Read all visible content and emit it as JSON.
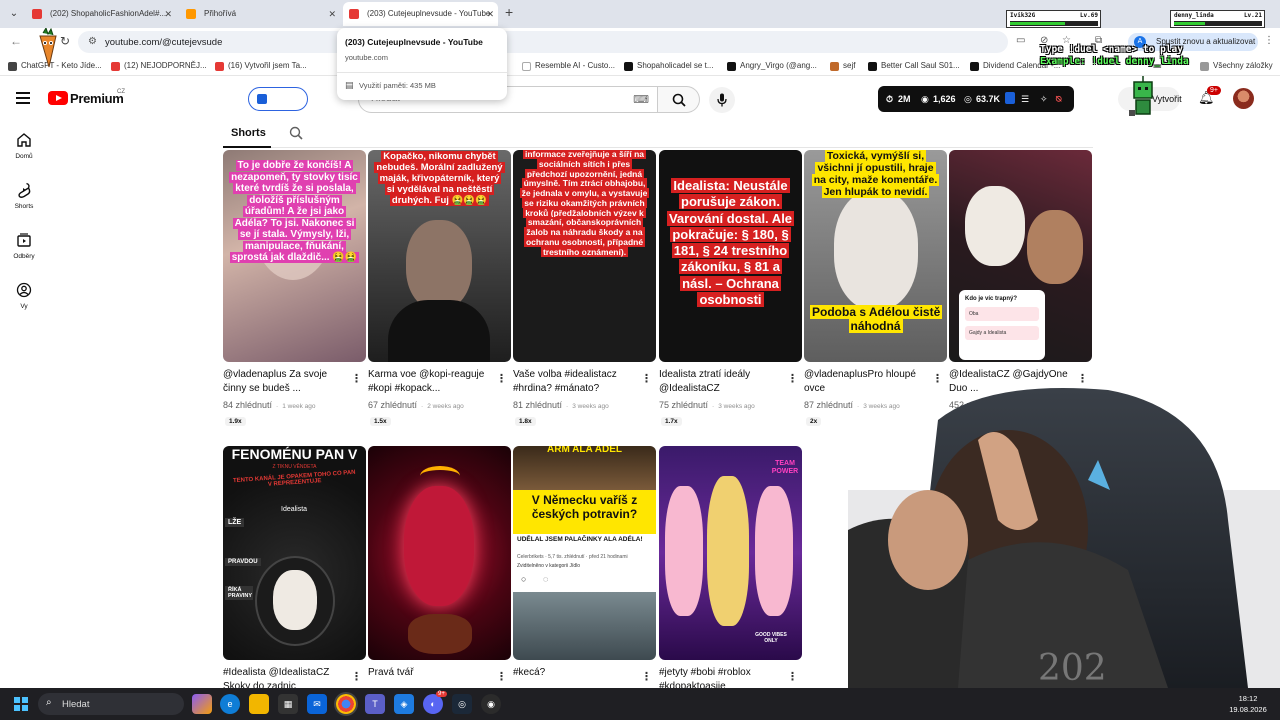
{
  "browser": {
    "tabs": [
      {
        "label": "(202) ShopaholicFashionAdel#...",
        "favicon_color": "#e53935"
      },
      {
        "label": "Přihořívá",
        "favicon_color": "#ff9800"
      },
      {
        "label": "(203) Cutejeuplnevsude - YouTube",
        "favicon_color": "#e53935"
      }
    ],
    "url": "youtube.com/@cutejevsude",
    "update_label": "Spustit znovu a aktualizovat",
    "bookmarks": [
      {
        "label": "ChatGPT - Keto Jíde...",
        "color": "#444"
      },
      {
        "label": "(12) NEJODPORNĚJ...",
        "color": "#e53935"
      },
      {
        "label": "(16) Vytvořil jsem Ta...",
        "color": "#e53935"
      },
      {
        "label": "Resemble AI - Custo...",
        "color": "#888"
      },
      {
        "label": "Shopaholicadel se t...",
        "color": "#111"
      },
      {
        "label": "Angry_Virgo (@ang...",
        "color": "#111"
      },
      {
        "label": "sejf",
        "color": "#c0692a"
      },
      {
        "label": "Better Call Saul S01...",
        "color": "#111"
      },
      {
        "label": "Dividend Calendar -...",
        "color": "#111"
      },
      {
        "label": "Všechny záložky",
        "color": "#777"
      }
    ],
    "tab_popup": {
      "title": "(203) Cutejeuplnevsude - YouTube",
      "host": "youtube.com",
      "memory": "Využití paměti: 435 MB"
    }
  },
  "youtube": {
    "logo_text": "Premium",
    "region": "CZ",
    "search_placeholder": "Hledat",
    "stats": {
      "s1": "2M",
      "s2": "1,626",
      "s3": "63.7K"
    },
    "create_label": "Vytvořit",
    "notifications": "9+",
    "sidebar": [
      {
        "label": "Domů",
        "icon": "home-icon"
      },
      {
        "label": "Shorts",
        "icon": "shorts-icon"
      },
      {
        "label": "Odběry",
        "icon": "subscriptions-icon"
      },
      {
        "label": "Vy",
        "icon": "you-icon"
      }
    ],
    "channel_tab": "Shorts",
    "shorts": [
      {
        "title": "@vladenaplus Za svoje činny se budeš ...",
        "views": "84 zhlédnutí",
        "ago": "1 week ago",
        "speed": "1.9x",
        "caption": "To je dobře že končíš! A nezapomeň, ty stovky tisíc které tvrdíš že si poslala, doložíš příslušným úřadům! A že jsi jako Adéla? To jsi. Nakonec si se jí stala. Výmysly, lži, manipulace, fňukání, sprostá jak dlaždič... 🤮🤮"
      },
      {
        "title": "Karma voe @kopi-reaguje #kopi #kopack...",
        "views": "67 zhlédnutí",
        "ago": "2 weeks ago",
        "speed": "1.5x",
        "caption": "Kopačko, nikomu chybět nebudeš. Morální zadlužený maják, křivopáterník, který si vydělával na neštěstí druhých. Fuj 🤮🤮🤮"
      },
      {
        "title": "Vaše volba #idealistacz #hrdina? #mánato?",
        "views": "81 zhlédnutí",
        "ago": "3 weeks ago",
        "speed": "1.8x",
        "caption": "informace zveřejňuje a šíří na sociálních sítích i přes předchozí upozornění, jedná úmyslně. Tím ztrácí obhajobu, že jednala v omylu, a vystavuje se riziku okamžitých právních kroků (předžalobních výzev k smazání, občanskoprávních žalob na náhradu škody a na ochranu osobnosti, případné trestního oznámení)."
      },
      {
        "title": "Idealista ztratí ideály @IdealistaCZ",
        "views": "75 zhlédnutí",
        "ago": "3 weeks ago",
        "speed": "1.7x",
        "caption": "Idealista: Neustále porušuje zákon. Varování dostal. Ale pokračuje: § 180, § 181, § 24 trestního zákoníku, § 81 a násl. – Ochrana osobnosti"
      },
      {
        "title": "@vladenaplusPro hloupé ovce",
        "views": "87 zhlédnutí",
        "ago": "3 weeks ago",
        "speed": "2x",
        "caption": "Toxická, vymýšlí si, všichni jí opustili, hraje na city, maže komentáře. Jen hlupák to nevidí.",
        "caption2": "Podoba s Adélou čistě náhodná"
      },
      {
        "title": "@IdealistaCZ @GajdyOne Duo ...",
        "views": "452 zhlédnutí",
        "ago": "",
        "speed": "",
        "poll_q": "Kdo je víc trapný?",
        "poll_a": "Oba",
        "poll_b": "Gajdy a Idealista"
      },
      {
        "title": "#Idealista @IdealistaCZ Skoky do zadnic",
        "views": "",
        "ago": "",
        "speed": "",
        "caption": "FENOMÉNU PAN V",
        "sub1": "Z TIKNU VĚNDETA",
        "sub2": "TENTO KANÁL JE OPAKEM TOHO CO PAN V REPREZENTUJE",
        "label": "Idealista",
        "side1": "LŽE",
        "side2": "PRAVDOU",
        "side3": "ŘÍKÁ PRAVINY"
      },
      {
        "title": "Pravá tvář",
        "views": "",
        "ago": "",
        "speed": ""
      },
      {
        "title": "#kecá?",
        "views": "",
        "ago": "",
        "speed": "",
        "top": "ARM ALA ADÉL",
        "caption": "V Německu vaříš z českých potravin?",
        "post_title": "UDĚLAL JSEM PALAČINKY ALA ADÉLA!",
        "post_meta": "Celerbrikets · 5,7 tis. zhlédnutí · před 21 hodinami",
        "post_cat": "Zviditelněno v kategorii Jídlo"
      },
      {
        "title": "#jetyty #bobi #roblox #kdopaktoasije",
        "views": "",
        "ago": "",
        "speed": "",
        "badge": "TEAM POWER",
        "mug": "GOOD VIBES ONLY"
      }
    ]
  },
  "overlay": {
    "hud1_name": "Ivik32G",
    "hud1_lvl": "Lv.69",
    "hud1_hp": 0.62,
    "hud2_name": "denny_linda",
    "hud2_lvl": "Lv.21",
    "hud2_hp": 0.35,
    "line1": "Type !duel <name> to play",
    "line2": "Example: !duel denny_linda"
  },
  "taskbar": {
    "search": "Hledat",
    "time": "18:12",
    "date": "19.08.2026",
    "discord_badge": "9+"
  }
}
